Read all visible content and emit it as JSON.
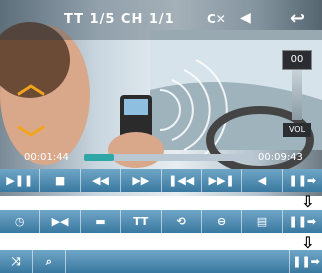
{
  "header": {
    "title_info": "TT  1/5  CH  1/1"
  },
  "progress": {
    "elapsed": "00:01:44",
    "total": "00:09:43",
    "fraction": 0.18
  },
  "volume": {
    "value": "00",
    "label": "VOL"
  },
  "row1": {
    "play_pause": "▶❚❚",
    "stop": "■",
    "rewind": "◀◀",
    "forward": "▶▶",
    "prev": "❚◀◀",
    "next": "▶▶❚",
    "mute": "◀",
    "more": "❚❚➡"
  },
  "row2": {
    "clock": "◷",
    "bookmark": "▶◀",
    "folder": "▬",
    "tt_info": "TT",
    "repeat": "⟲",
    "audio": "⊖",
    "display": "▤",
    "more": "❚❚➡"
  },
  "row3": {
    "shuffle": "⤨",
    "search": "⌕",
    "more": "❚❚➡"
  },
  "arrows": {
    "down": "⇩"
  },
  "colors": {
    "bar": "#4a86b0",
    "progress": "#2fa7a6"
  }
}
